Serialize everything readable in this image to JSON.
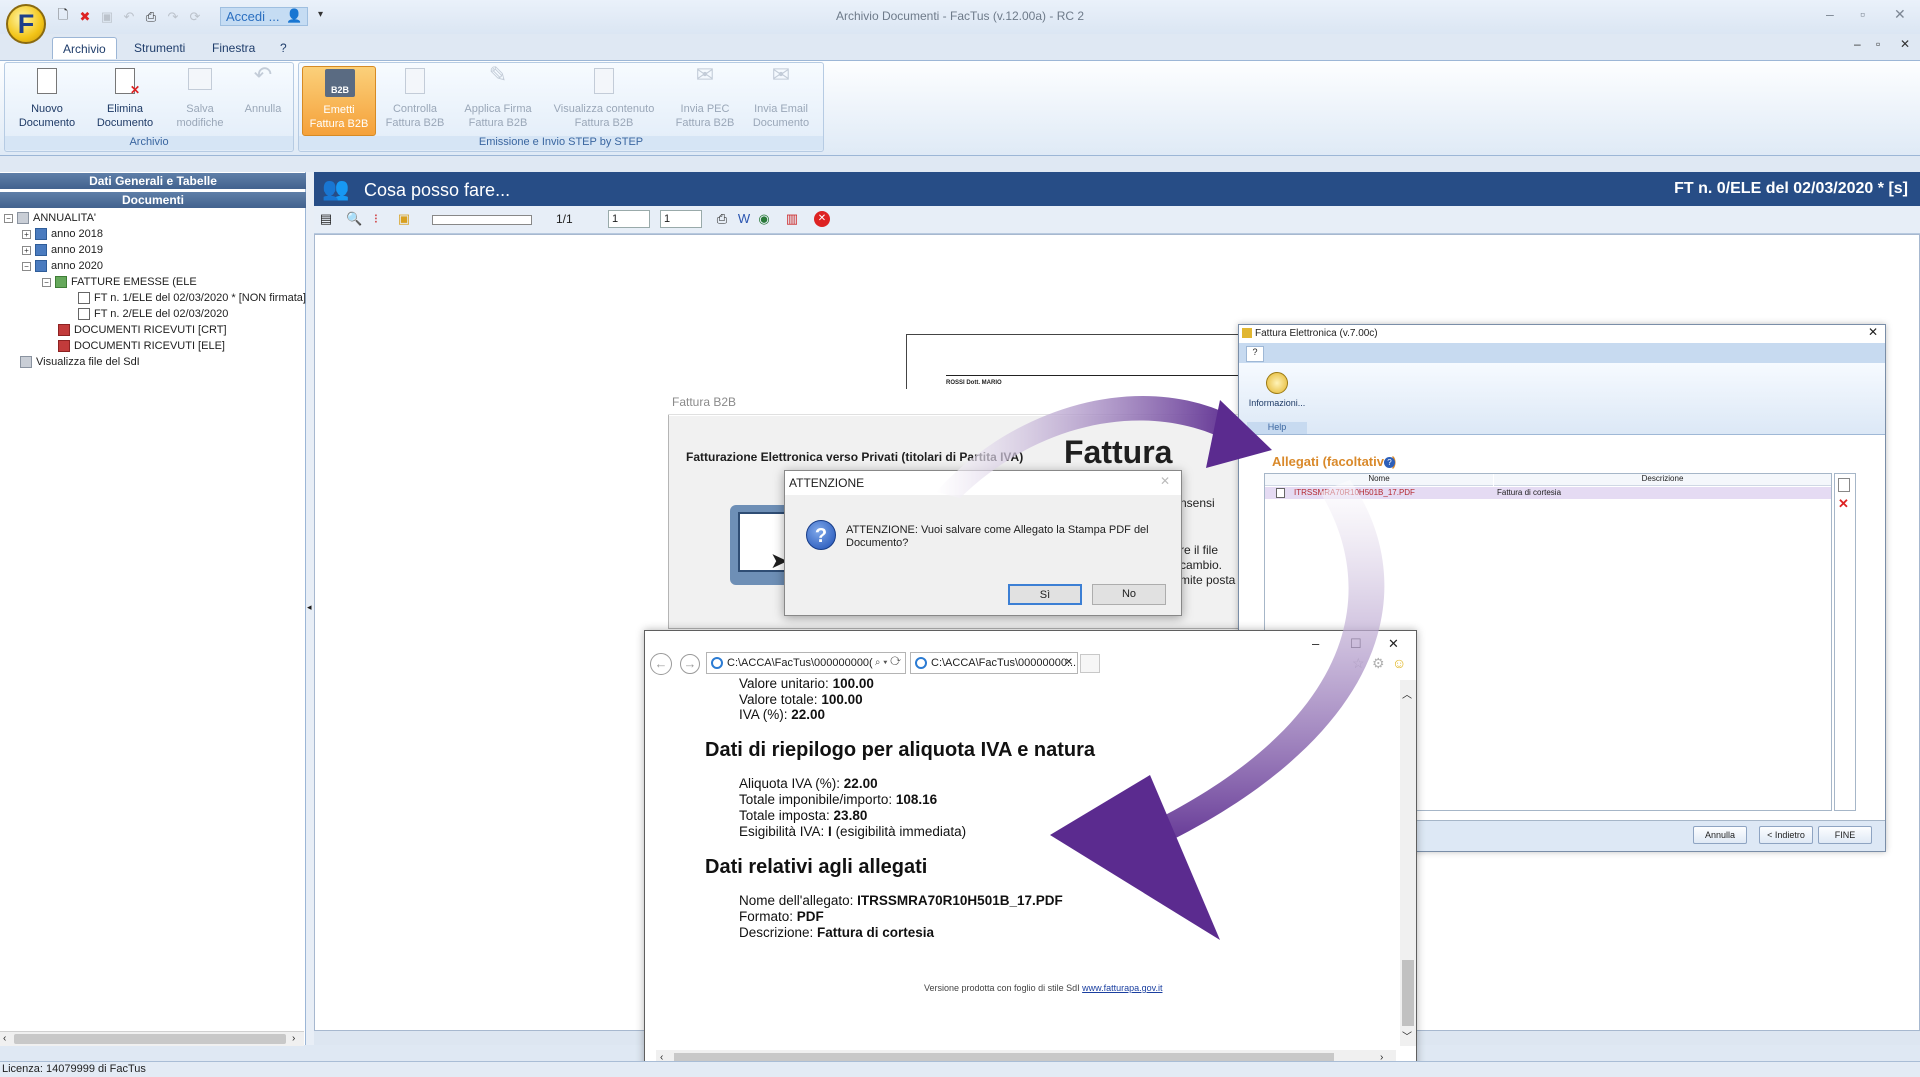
{
  "app": {
    "logo_letter": "F",
    "window_title": "Archivio Documenti - FacTus (v.12.00a) - RC 2",
    "accedi_label": "Accedi ...",
    "win_min": "–",
    "win_max": "▫",
    "win_close": "✕",
    "mdi_min": "–",
    "mdi_max": "▫",
    "mdi_close": "✕"
  },
  "menu": {
    "tabs": [
      "Archivio",
      "Strumenti",
      "Finestra",
      "?"
    ],
    "active": "Archivio"
  },
  "ribbon": {
    "groups": [
      {
        "label": "Archivio"
      },
      {
        "label": "Emissione e Invio STEP by STEP"
      }
    ],
    "buttons": [
      {
        "line1": "Nuovo",
        "line2": "Documento",
        "enabled": true
      },
      {
        "line1": "Elimina",
        "line2": "Documento",
        "enabled": true
      },
      {
        "line1": "Salva",
        "line2": "modifiche",
        "enabled": false
      },
      {
        "line1": "Annulla",
        "line2": "",
        "enabled": false
      },
      {
        "line1": "Emetti",
        "line2": "Fattura B2B",
        "enabled": true,
        "active": true,
        "badge": "B2B"
      },
      {
        "line1": "Controlla",
        "line2": "Fattura B2B",
        "enabled": false
      },
      {
        "line1": "Applica Firma",
        "line2": "Fattura B2B",
        "enabled": false
      },
      {
        "line1": "Visualizza contenuto",
        "line2": "Fattura B2B",
        "enabled": false
      },
      {
        "line1": "Invia PEC",
        "line2": "Fattura B2B",
        "enabled": false
      },
      {
        "line1": "Invia Email",
        "line2": "Documento",
        "enabled": false
      }
    ]
  },
  "left_panel": {
    "header1": "Dati Generali e Tabelle",
    "header2": "Documenti",
    "tree": [
      {
        "label": "ANNUALITA'",
        "expander": "−"
      },
      {
        "label": "anno  2018",
        "expander": "+"
      },
      {
        "label": "anno  2019",
        "expander": "+"
      },
      {
        "label": "anno  2020",
        "expander": "−"
      },
      {
        "label": "FATTURE EMESSE (ELE",
        "expander": "−"
      },
      {
        "label": "FT n.  1/ELE del 02/03/2020 * [NON firmata]"
      },
      {
        "label": "FT n.  2/ELE del 02/03/2020"
      },
      {
        "label": "DOCUMENTI RICEVUTI [CRT]"
      },
      {
        "label": "DOCUMENTI RICEVUTI [ELE]"
      },
      {
        "label": "Visualizza file del SdI"
      }
    ]
  },
  "main": {
    "title": "Cosa posso fare...",
    "doc_ref": "FT n. 0/ELE del 02/03/2020 * [s]",
    "page_indicator": "1/1",
    "spin1": "1",
    "spin2": "1"
  },
  "status_bar": {
    "text": "Licenza: 14079999 di FacTus"
  },
  "back_doc": {
    "name": "ROSSI Dott. MARIO"
  },
  "b2b_window": {
    "title": "Fattura B2B",
    "heading": "Fatturazione Elettronica verso Privati (titolari di Partita IVA)",
    "big_word": "Fattura",
    "frag1": "nsensi",
    "frag2": "re il file",
    "frag3": "cambio.",
    "frag4": "mite posta"
  },
  "fe_window": {
    "title": "Fattura Elettronica (v.7.00c)",
    "tab_label": "?",
    "info_label": "Informazioni...",
    "help_label": "Help",
    "section": "Allegati (facoltativo)",
    "col_nome": "Nome",
    "col_desc": "Descrizione",
    "row_nome": "ITRSSMRA70R10H501B_17.PDF",
    "row_desc": "Fattura di cortesia",
    "btn_annulla": "Annulla",
    "btn_indietro": "< Indietro",
    "btn_fine": "FINE"
  },
  "dialog": {
    "title": "ATTENZIONE",
    "message": "ATTENZIONE: Vuoi salvare come Allegato la Stampa PDF del Documento?",
    "btn_yes": "Sì",
    "btn_no": "No"
  },
  "browser": {
    "address": "C:\\ACCA\\FacTus\\000000000(",
    "tab": "C:\\ACCA\\FacTus\\00000000...",
    "lines_top": [
      {
        "label": "Valore unitario: ",
        "value": "100.00"
      },
      {
        "label": "Valore totale: ",
        "value": "100.00"
      },
      {
        "label": "IVA (%): ",
        "value": "22.00"
      }
    ],
    "heading1": "Dati di riepilogo per aliquota IVA e natura",
    "lines_mid": [
      {
        "label": "Aliquota IVA (%): ",
        "value": "22.00"
      },
      {
        "label": "Totale imponibile/importo: ",
        "value": "108.16"
      },
      {
        "label": "Totale imposta: ",
        "value": "23.80"
      },
      {
        "label": "Esigibilità IVA: ",
        "value": "I",
        "extra": " (esigibilità immediata)"
      }
    ],
    "heading2": "Dati relativi agli allegati",
    "lines_bot": [
      {
        "label": "Nome dell'allegato: ",
        "value": "ITRSSMRA70R10H501B_17.PDF"
      },
      {
        "label": "Formato: ",
        "value": "PDF"
      },
      {
        "label": "Descrizione: ",
        "value": "Fattura di cortesia"
      }
    ],
    "footer_text": "Versione prodotta con foglio di stile SdI ",
    "footer_link": "www.fatturapa.gov.it"
  },
  "colors": {
    "accent_dark": "#274d86",
    "arrow_purple": "#5b2b8f",
    "ribbon_active": "#f5a13a"
  }
}
